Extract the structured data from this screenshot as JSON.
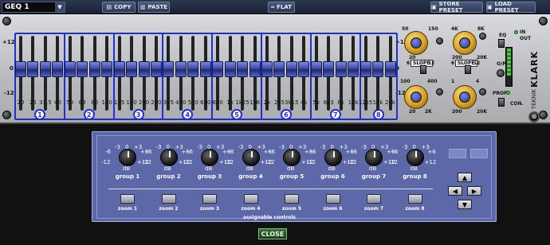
{
  "toolbar": {
    "preset_name": "GEQ 1",
    "copy_label": "COPY",
    "paste_label": "PASTE",
    "flat_label": "FLAT",
    "store_preset_label": "STORE PRESET",
    "load_preset_label": "LOAD PRESET"
  },
  "rack": {
    "scale_top": "+12",
    "scale_mid": "0",
    "scale_bottom": "-12",
    "scale_top_right": "+12",
    "scale_mid_right": "0",
    "scale_bottom_right": "-12",
    "bands": [
      "1",
      "2",
      "3",
      "4",
      "5",
      "6",
      "7",
      "8"
    ],
    "frequencies": [
      "20",
      "25",
      "31.5",
      "40",
      "50",
      "63",
      "80",
      "100",
      "125",
      "160",
      "200",
      "250",
      "315",
      "400",
      "500",
      "630",
      "800",
      "1k",
      "1k25",
      "1k6",
      "2k",
      "2k5",
      "3k15",
      "4k",
      "5k",
      "6k3",
      "8k",
      "10k",
      "12k5",
      "16k",
      "20k"
    ],
    "filters": {
      "knob1_min": "20",
      "knob1_max": "150",
      "knob1_lo": "50",
      "knob2_min": "200",
      "knob2_max": "20K",
      "knob2_lo": "4K",
      "knob2_hi": "8K",
      "slope_label": "SLOPE",
      "slope1_a": "6",
      "slope1_b": "12",
      "slope2_a": "6",
      "slope2_b": "12",
      "knob3_min": "20",
      "knob3_max": "2K",
      "knob3_lo": "100",
      "knob3_hi": "400",
      "knob4_min": "200",
      "knob4_max": "20K",
      "knob4_lo": "1",
      "knob4_hi": "4",
      "eq_label": "EQ",
      "eq_in": "IN",
      "eq_out": "OUT",
      "op_label": "O/P",
      "prop_label": "PROP",
      "con_label": "CON.",
      "brand": "KLARK",
      "brand_sub": "TEKNIK",
      "brand_mark": "⊗"
    }
  },
  "assignable": {
    "groups": [
      {
        "label": "group 1",
        "db": "dB",
        "t0": "0",
        "tm3": "-3",
        "tp3": "+3",
        "tm6": "-6",
        "tp6": "+6",
        "tm12": "-12",
        "tp12": "+12"
      },
      {
        "label": "group 2",
        "db": "dB",
        "t0": "0",
        "tm3": "-3",
        "tp3": "+3",
        "tm6": "-6",
        "tp6": "+6",
        "tm12": "-12",
        "tp12": "+12"
      },
      {
        "label": "group 3",
        "db": "dB",
        "t0": "0",
        "tm3": "-3",
        "tp3": "+3",
        "tm6": "-6",
        "tp6": "+6",
        "tm12": "-12",
        "tp12": "+12"
      },
      {
        "label": "group 4",
        "db": "dB",
        "t0": "0",
        "tm3": "-3",
        "tp3": "+3",
        "tm6": "-6",
        "tp6": "+6",
        "tm12": "-12",
        "tp12": "+12"
      },
      {
        "label": "group 5",
        "db": "dB",
        "t0": "0",
        "tm3": "-3",
        "tp3": "+3",
        "tm6": "-6",
        "tp6": "+6",
        "tm12": "-12",
        "tp12": "+12"
      },
      {
        "label": "group 6",
        "db": "dB",
        "t0": "0",
        "tm3": "-3",
        "tp3": "+3",
        "tm6": "-6",
        "tp6": "+6",
        "tm12": "-12",
        "tp12": "+12"
      },
      {
        "label": "group 7",
        "db": "dB",
        "t0": "0",
        "tm3": "-3",
        "tp3": "+3",
        "tm6": "-6",
        "tp6": "+6",
        "tm12": "-12",
        "tp12": "+12"
      },
      {
        "label": "group 8",
        "db": "dB",
        "t0": "0",
        "tm3": "-3",
        "tp3": "+3",
        "tm6": "-6",
        "tp6": "+6",
        "tm12": "-12",
        "tp12": "+12"
      }
    ],
    "zooms": [
      "zoom 1",
      "zoom 2",
      "zoom 3",
      "zoom 4",
      "zoom 5",
      "zoom 6",
      "zoom 7",
      "zoom 8"
    ],
    "footer_label": "assignable controls",
    "arrows": {
      "up": "▲",
      "left": "◀",
      "right": "▶",
      "down": "▼"
    }
  },
  "close_label": "CLOSE",
  "colors": {
    "band_outline": "#1e2fd8",
    "panel": "#5d68a8",
    "close": "#2d5f2d"
  }
}
